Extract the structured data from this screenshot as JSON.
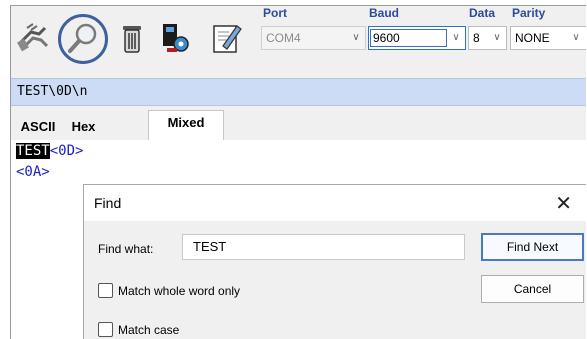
{
  "toolbar": {
    "icons": [
      "connect-icon",
      "find-icon",
      "trash-icon",
      "settings-icon",
      "edit-icon"
    ],
    "port": {
      "label": "Port",
      "value": "COM4"
    },
    "baud": {
      "label": "Baud",
      "value": "9600"
    },
    "data": {
      "label": "Data",
      "value": "8"
    },
    "parity": {
      "label": "Parity",
      "value": "NONE"
    }
  },
  "command_line": {
    "text": "TEST\\0D\\n"
  },
  "tabs": [
    {
      "label": "ASCII"
    },
    {
      "label": "Hex"
    },
    {
      "label": "Mixed",
      "selected": true
    }
  ],
  "content": {
    "line1_selected": "TEST",
    "line1_code": "<0D>",
    "line2_code": "<0A>"
  },
  "find_dialog": {
    "title": "Find",
    "close": "✕",
    "find_what_label": "Find what:",
    "find_what_value": "TEST",
    "find_next": "Find Next",
    "cancel": "Cancel",
    "match_whole_word": "Match whole word only",
    "match_case": "Match case"
  },
  "colors": {
    "label_blue": "#2a4c9c",
    "command_line_bg": "#ccdcf6",
    "code_blue": "#1c1cc8",
    "highlight_ring": "#3f5f9f"
  }
}
